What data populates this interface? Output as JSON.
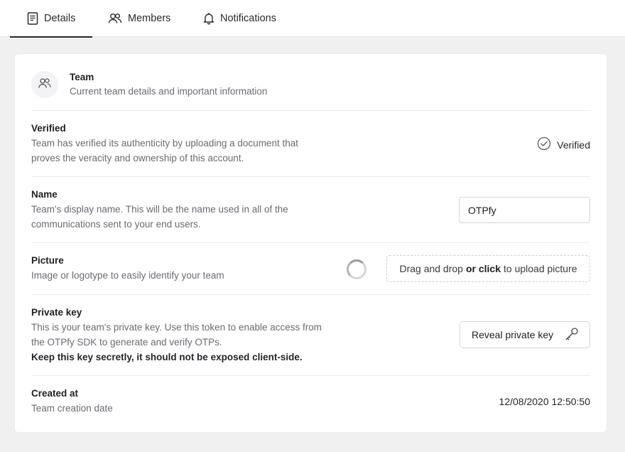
{
  "tabs": [
    {
      "label": "Details",
      "icon": "document-icon",
      "active": true
    },
    {
      "label": "Members",
      "icon": "users-icon",
      "active": false
    },
    {
      "label": "Notifications",
      "icon": "bell-icon",
      "active": false
    }
  ],
  "team": {
    "title": "Team",
    "subtitle": "Current team details and important information"
  },
  "verified": {
    "title": "Verified",
    "description": "Team has verified its authenticity by uploading a document that proves the veracity and ownership of this account.",
    "status_label": "Verified"
  },
  "name": {
    "title": "Name",
    "description": "Team's display name. This will be the name used in all of the communications sent to your end users.",
    "value": "OTPfy"
  },
  "picture": {
    "title": "Picture",
    "description": "Image or logotype to easily identify your team",
    "upload_part1": "Drag and drop",
    "upload_part2": "or click",
    "upload_part3": "to upload picture"
  },
  "private_key": {
    "title": "Private key",
    "description": "This is your team's private key. Use this token to enable access from the OTPfy SDK to generate and verify OTPs.",
    "warning": "Keep this key secretly, it should not be exposed client-side.",
    "button_label": "Reveal private key"
  },
  "created_at": {
    "title": "Created at",
    "description": "Team creation date",
    "value": "12/08/2020 12:50:50"
  },
  "colors": {
    "page_background": "#f0f0f1",
    "card_background": "#ffffff",
    "text_primary": "#1f1f22",
    "text_secondary": "#6b6b72",
    "active_tab_indicator": "#27272a"
  }
}
